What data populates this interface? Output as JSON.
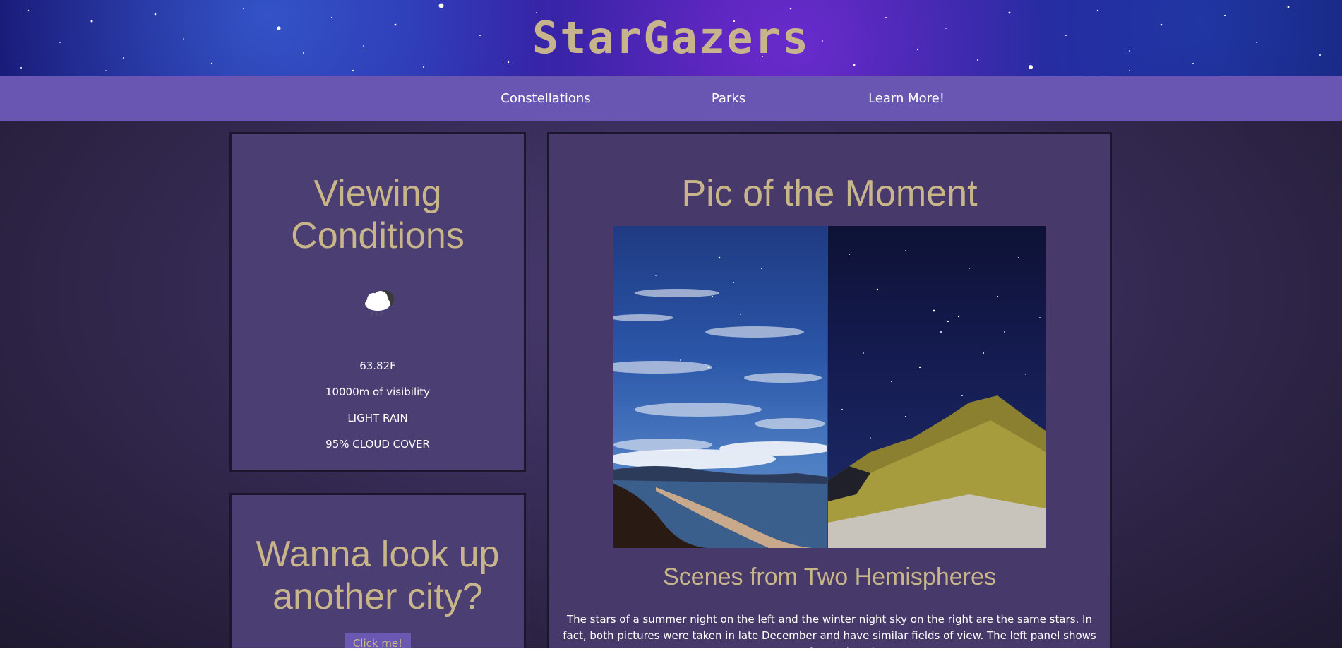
{
  "header": {
    "site_title": "StarGazers"
  },
  "nav": {
    "items": [
      {
        "label": "Constellations"
      },
      {
        "label": "Parks"
      },
      {
        "label": "Learn More!"
      }
    ]
  },
  "viewing_conditions": {
    "title": "Viewing Conditions",
    "weather_icon": "cloud-rain-moon-icon",
    "temperature": "63.82F",
    "visibility": "10000m of visibility",
    "description": "LIGHT RAIN",
    "cloud_cover": "95% CLOUD COVER"
  },
  "city_lookup": {
    "title": "Wanna look up another city?",
    "button_label": "Click me!"
  },
  "pic_of_moment": {
    "title": "Pic of the Moment",
    "subtitle": "Scenes from Two Hemispheres",
    "caption": "The stars of a summer night on the left and the winter night sky on the right are the same stars. In fact, both pictures were taken in late December and have similar fields of view. The left panel shows a scene from a beach on"
  },
  "colors": {
    "accent_gold": "#c9b58a",
    "nav_purple": "#6856b2",
    "panel_purple": "#4b3e72"
  }
}
